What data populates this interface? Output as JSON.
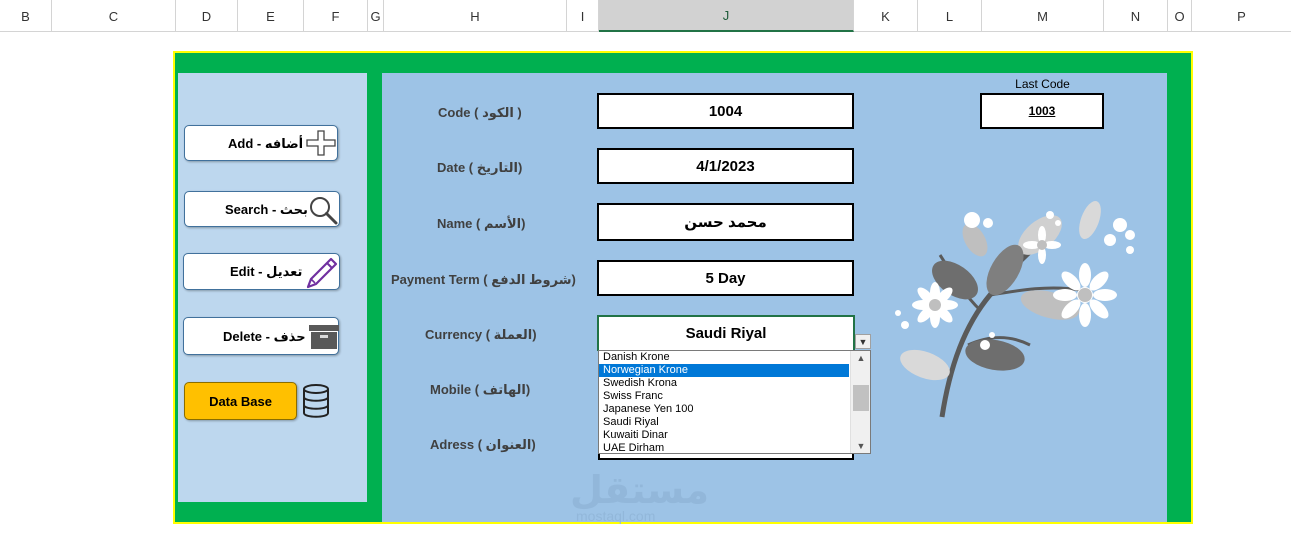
{
  "columns": [
    {
      "id": "B",
      "w": 52
    },
    {
      "id": "C",
      "w": 100
    },
    {
      "id": "D",
      "w": 64
    },
    {
      "id": "E",
      "w": 64
    },
    {
      "id": "F",
      "w": 64
    },
    {
      "id": "G",
      "w": 16
    },
    {
      "id": "H",
      "w": 200
    },
    {
      "id": "I",
      "w": 32
    },
    {
      "id": "J",
      "w": 254
    },
    {
      "id": "K",
      "w": 64
    },
    {
      "id": "L",
      "w": 64
    },
    {
      "id": "M",
      "w": 122
    },
    {
      "id": "N",
      "w": 64
    },
    {
      "id": "O",
      "w": 24
    },
    {
      "id": "P",
      "w": 100
    }
  ],
  "buttons": {
    "add": "Add - أضافه",
    "search": "Search - بحث",
    "edit": "Edit  - تعديل",
    "delete": "Delete - حذف",
    "database": "Data Base"
  },
  "fields": {
    "code": {
      "label": "Code ( الكود )",
      "value": "1004"
    },
    "date": {
      "label": "Date ( التاريخ)",
      "value": "4/1/2023"
    },
    "name": {
      "label": "Name ( الأسم)",
      "value": "محمد حسن"
    },
    "payment_term": {
      "label": "Payment Term ( شروط الدفع)",
      "value": "5 Day"
    },
    "currency": {
      "label": "Currency ( العملة)",
      "value": "Saudi Riyal"
    },
    "mobile": {
      "label": "Mobile ( الهاتف)"
    },
    "address": {
      "label": "Adress ( العنوان)"
    }
  },
  "last_code": {
    "label": "Last Code",
    "value": "1003"
  },
  "currency_dropdown": {
    "options": [
      "Danish Krone",
      "Norwegian Krone",
      "Swedish Krona",
      "Swiss Franc",
      "Japanese Yen 100",
      "Saudi Riyal",
      "Kuwaiti Dinar",
      "UAE Dirham"
    ],
    "highlighted_index": 1
  },
  "watermark": {
    "text": "مستقل",
    "sub": "mostaql.com"
  },
  "colors": {
    "frame_green": "#00b050",
    "frame_border": "#ffff00",
    "main_blue": "#9dc3e6",
    "side_blue": "#bdd7ee",
    "db_button": "#ffc000"
  }
}
